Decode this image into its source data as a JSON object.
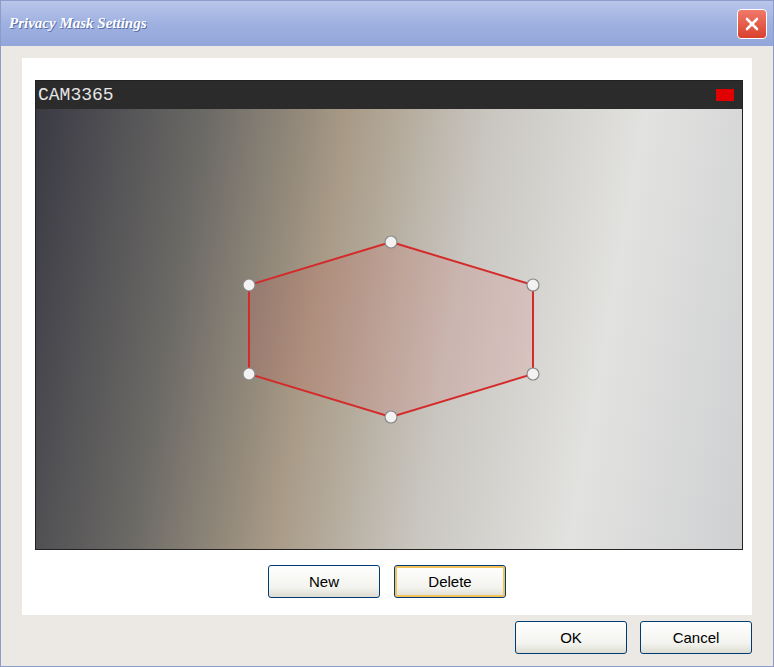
{
  "window": {
    "title": "Privacy Mask Settings"
  },
  "viewer": {
    "camera": "CAM3365",
    "recording": true,
    "recording_color": "#e00000"
  },
  "mask_buttons": [
    {
      "label": "New",
      "hot": false
    },
    {
      "label": "Delete",
      "hot": true
    }
  ],
  "buttons": [
    {
      "label": "OK",
      "hot": false
    },
    {
      "label": "Cancel",
      "hot": false
    }
  ]
}
